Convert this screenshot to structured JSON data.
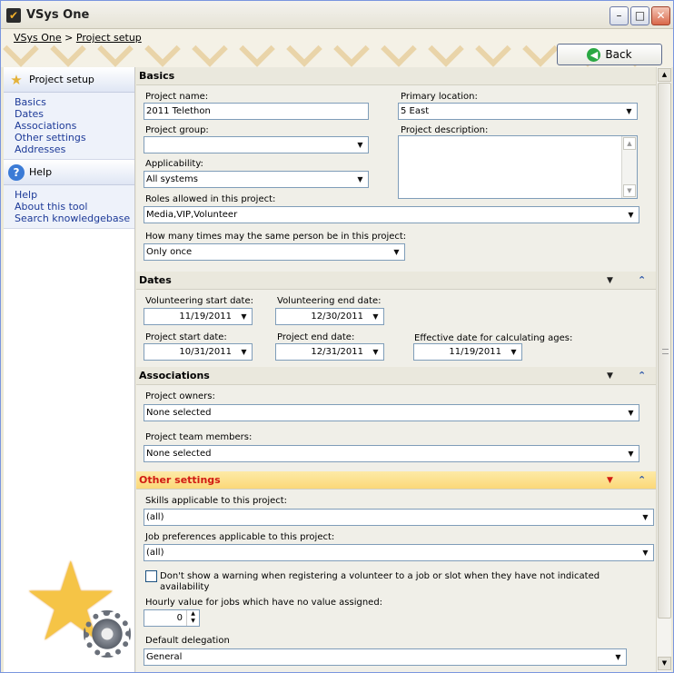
{
  "window": {
    "title": "VSys One"
  },
  "breadcrumb": {
    "home": "VSys One",
    "separator": ">",
    "current": "Project setup"
  },
  "back_button": {
    "label": "Back"
  },
  "sidebar": {
    "project_setup": {
      "title": "Project setup",
      "links": [
        "Basics",
        "Dates",
        "Associations",
        "Other settings",
        "Addresses"
      ]
    },
    "help": {
      "title": "Help",
      "links": [
        "Help",
        "About this tool",
        "Search knowledgebase"
      ]
    }
  },
  "basics": {
    "title": "Basics",
    "project_name_label": "Project name:",
    "project_name_value": "2011 Telethon",
    "primary_location_label": "Primary location:",
    "primary_location_value": "5 East",
    "project_group_label": "Project group:",
    "project_group_value": "",
    "project_description_label": "Project description:",
    "project_description_value": "",
    "applicability_label": "Applicability:",
    "applicability_value": "All systems",
    "roles_label": "Roles allowed in this project:",
    "roles_value": "Media,VIP,Volunteer",
    "times_label": "How many times may the same person be in this project:",
    "times_value": "Only once"
  },
  "dates": {
    "title": "Dates",
    "vol_start_label": "Volunteering start date:",
    "vol_start_value": "11/19/2011",
    "vol_end_label": "Volunteering end date:",
    "vol_end_value": "12/30/2011",
    "proj_start_label": "Project start date:",
    "proj_start_value": "10/31/2011",
    "proj_end_label": "Project end date:",
    "proj_end_value": "12/31/2011",
    "effective_label": "Effective date for calculating ages:",
    "effective_value": "11/19/2011"
  },
  "associations": {
    "title": "Associations",
    "owners_label": "Project owners:",
    "owners_value": "None selected",
    "members_label": "Project team members:",
    "members_value": "None selected"
  },
  "other_settings": {
    "title": "Other settings",
    "skills_label": "Skills applicable to this project:",
    "skills_value": "(all)",
    "job_prefs_label": "Job preferences applicable to this project:",
    "job_prefs_value": "(all)",
    "warning_checkbox_label": "Don't show a warning when registering a volunteer to a job or slot when they have not indicated availability",
    "warning_checked": false,
    "hourly_label": "Hourly value for jobs which have no value assigned:",
    "hourly_value": "0",
    "delegation_label": "Default delegation",
    "delegation_value": "General"
  },
  "icons": {
    "dropdown": "▼",
    "collapse": "⌃",
    "section_toggle": "▼"
  }
}
